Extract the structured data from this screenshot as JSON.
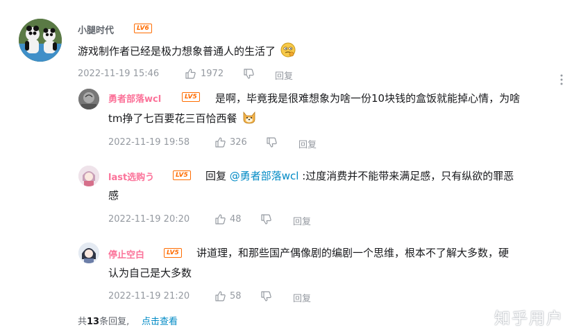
{
  "colors": {
    "mention": "#008ac5",
    "meta": "#9499a0",
    "lv6": "#ff6c00",
    "lv5": "#ff6c00",
    "reply_name": "#fb7299"
  },
  "root": {
    "username": "小腿时代",
    "level": "LV6",
    "content": "游戏制作者已经是极力想象普通人的生活了",
    "emoji": "thinking-emoji",
    "time": "2022-11-19 15:46",
    "likes": "1972",
    "reply_label": "回复"
  },
  "replies": [
    {
      "username": "勇者部落wcl",
      "level": "LV5",
      "line1": "是啊，毕竟我是很难想象为啥一份10块钱的盒饭就能掉心情，为啥",
      "line2": "tm挣了七百要花三百恰西餐",
      "emoji": "dog-emoji",
      "time": "2022-11-19 19:58",
      "likes": "326",
      "reply_label": "回复"
    },
    {
      "username": "last选购う",
      "level": "LV5",
      "prefix": "回复 ",
      "mention": "@勇者部落wcl",
      "line1": " :过度消费并不能带来满足感，只有纵欲的罪恶",
      "line2": "感",
      "time": "2022-11-19 20:20",
      "likes": "48",
      "reply_label": "回复"
    },
    {
      "username": "停止空白",
      "level": "LV5",
      "line1": "讲道理，和那些国产偶像剧的编剧一个思维，根本不了解大多数，硬",
      "line2": "认为自己是大多数",
      "time": "2022-11-19 21:20",
      "likes": "58",
      "reply_label": "回复"
    }
  ],
  "footer": {
    "total_prefix": "共",
    "total_count": "13",
    "total_suffix": "条回复,",
    "view_more": "点击查看"
  },
  "watermark": "知乎用户"
}
